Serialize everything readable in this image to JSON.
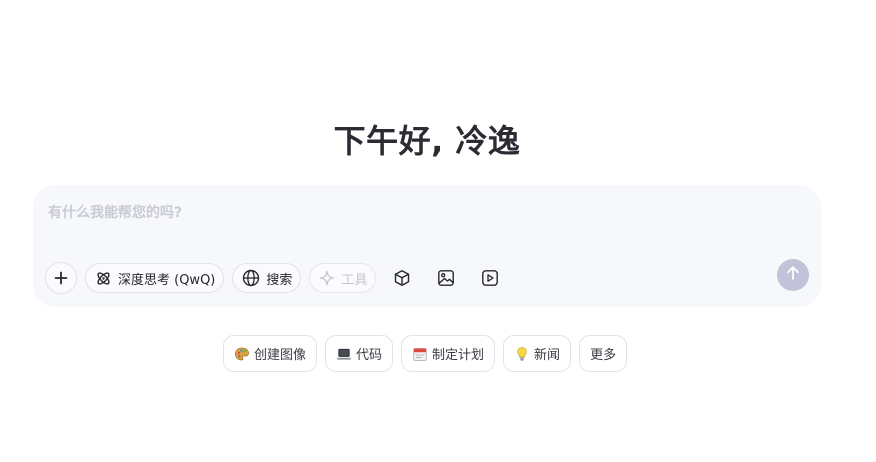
{
  "greeting": "下午好, 冷逸",
  "composer": {
    "placeholder": "有什么我能帮您的吗?",
    "add_label": "+",
    "deep_think_label": "深度思考 (QwQ)",
    "search_label": "搜索",
    "tools_label": "工具",
    "icons": [
      "plus-icon",
      "atom-icon",
      "globe-icon",
      "sparkle-icon",
      "cube-icon",
      "image-icon",
      "video-icon",
      "arrow-up-icon"
    ],
    "send_color": "#c2c3d8"
  },
  "chips": [
    {
      "label": "创建图像",
      "icon": "palette-icon"
    },
    {
      "label": "代码",
      "icon": "laptop-icon"
    },
    {
      "label": "制定计划",
      "icon": "calendar-icon"
    },
    {
      "label": "新闻",
      "icon": "lightbulb-icon"
    },
    {
      "label": "更多",
      "icon": ""
    }
  ]
}
